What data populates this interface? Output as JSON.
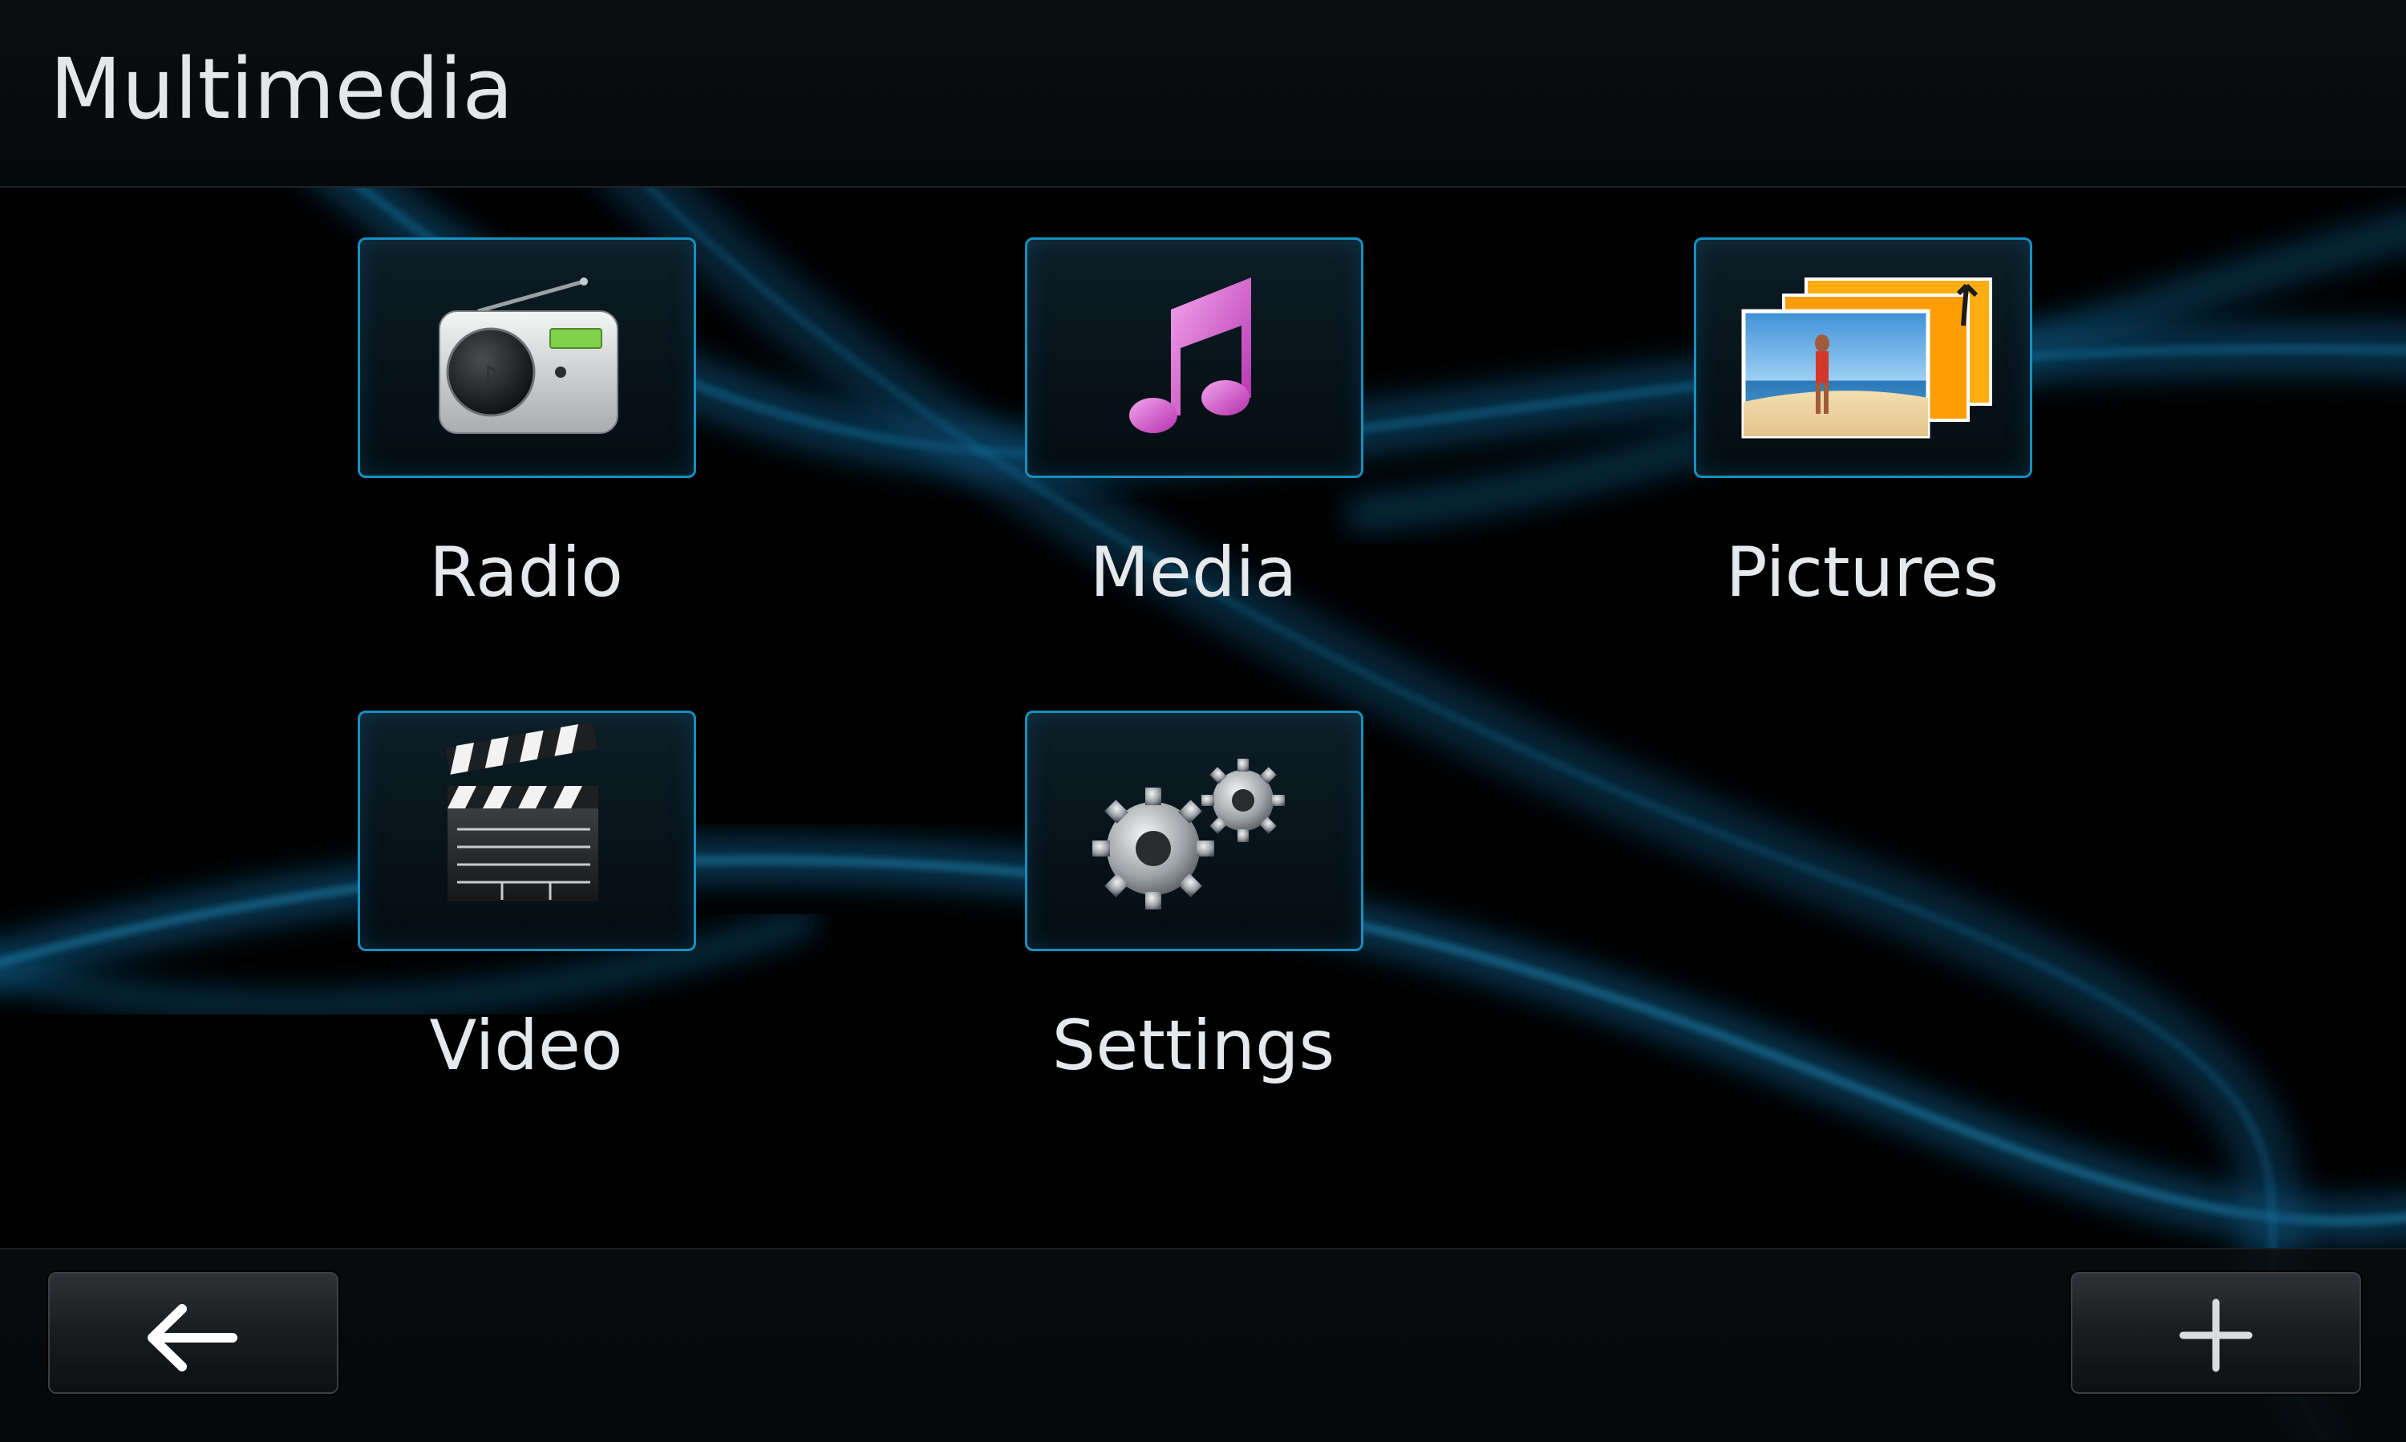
{
  "header": {
    "title": "Multimedia"
  },
  "menu": {
    "items": [
      {
        "label": "Radio",
        "icon": "radio-icon"
      },
      {
        "label": "Media",
        "icon": "music-note-icon"
      },
      {
        "label": "Pictures",
        "icon": "pictures-icon"
      },
      {
        "label": "Video",
        "icon": "clapperboard-icon"
      },
      {
        "label": "Settings",
        "icon": "gears-icon"
      }
    ]
  },
  "footer": {
    "back_icon": "back-arrow-icon",
    "add_icon": "plus-icon"
  },
  "colors": {
    "accent": "#1590bf",
    "background": "#000000",
    "text": "#e6e9ec"
  }
}
